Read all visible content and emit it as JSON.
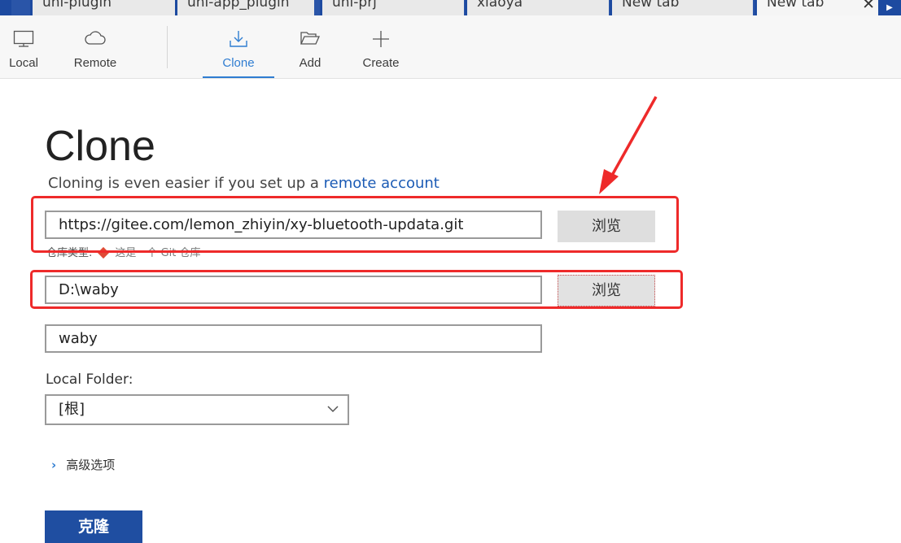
{
  "tabs": [
    {
      "label": "uni-plugin"
    },
    {
      "label": "uni-app_plugin"
    },
    {
      "label": "uni-prj"
    },
    {
      "label": "xiaoya"
    },
    {
      "label": "New tab"
    },
    {
      "label": "New tab",
      "active": true
    }
  ],
  "toolbar": {
    "items": [
      {
        "label": "Local",
        "icon": "monitor-icon"
      },
      {
        "label": "Remote",
        "icon": "cloud-icon"
      },
      {
        "label": "Clone",
        "icon": "download-icon",
        "active": true
      },
      {
        "label": "Add",
        "icon": "folder-open-icon"
      },
      {
        "label": "Create",
        "icon": "plus-icon"
      }
    ]
  },
  "page": {
    "title": "Clone",
    "subtitle_prefix": "Cloning is even easier if you set up a ",
    "subtitle_link": "remote account"
  },
  "form": {
    "url_value": "https://gitee.com/lemon_zhiyin/xy-bluetooth-updata.git",
    "browse_label": "浏览",
    "repo_type_prefix": "仓库类型:",
    "repo_type_text": "这是一个 Git 仓库",
    "path_value": "D:\\waby",
    "name_value": "waby",
    "local_folder_label": "Local Folder:",
    "local_folder_value": "[根]",
    "advanced_label": "高级选项",
    "clone_button": "克隆"
  },
  "colors": {
    "accent": "#2f7dd1",
    "primary_button": "#1f4ea1",
    "annotation": "#ee2a2a",
    "tab_border": "#1d4aa0"
  }
}
